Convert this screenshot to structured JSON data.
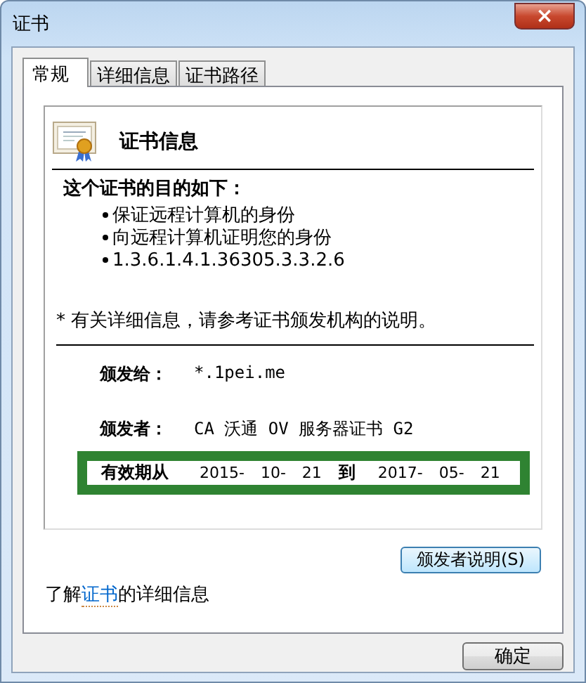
{
  "window": {
    "title": "证书",
    "close": "×"
  },
  "tabs": [
    {
      "label": "常规",
      "selected": true
    },
    {
      "label": "详细信息",
      "selected": false
    },
    {
      "label": "证书路径",
      "selected": false
    }
  ],
  "certificate": {
    "heading": "证书信息",
    "purpose_title": "这个证书的目的如下：",
    "purposes": [
      "保证远程计算机的身份",
      "向远程计算机证明您的身份",
      "1.3.6.1.4.1.36305.3.3.2.6"
    ],
    "note": "* 有关详细信息，请参考证书颁发机构的说明。",
    "fields": [
      {
        "label": "颁发给：",
        "value": "*.1pei.me"
      },
      {
        "label": "颁发者：",
        "value": "CA 沃通 OV 服务器证书 G2"
      }
    ],
    "validity": {
      "label": "有效期从",
      "from": "2015- 10- 21",
      "to_label": "到",
      "to": "2017- 05- 21"
    }
  },
  "issuer_button": "颁发者说明(S)",
  "learn_more": {
    "prefix": "了解",
    "link": "证书",
    "suffix": "的详细信息"
  },
  "ok_button": "确定"
}
